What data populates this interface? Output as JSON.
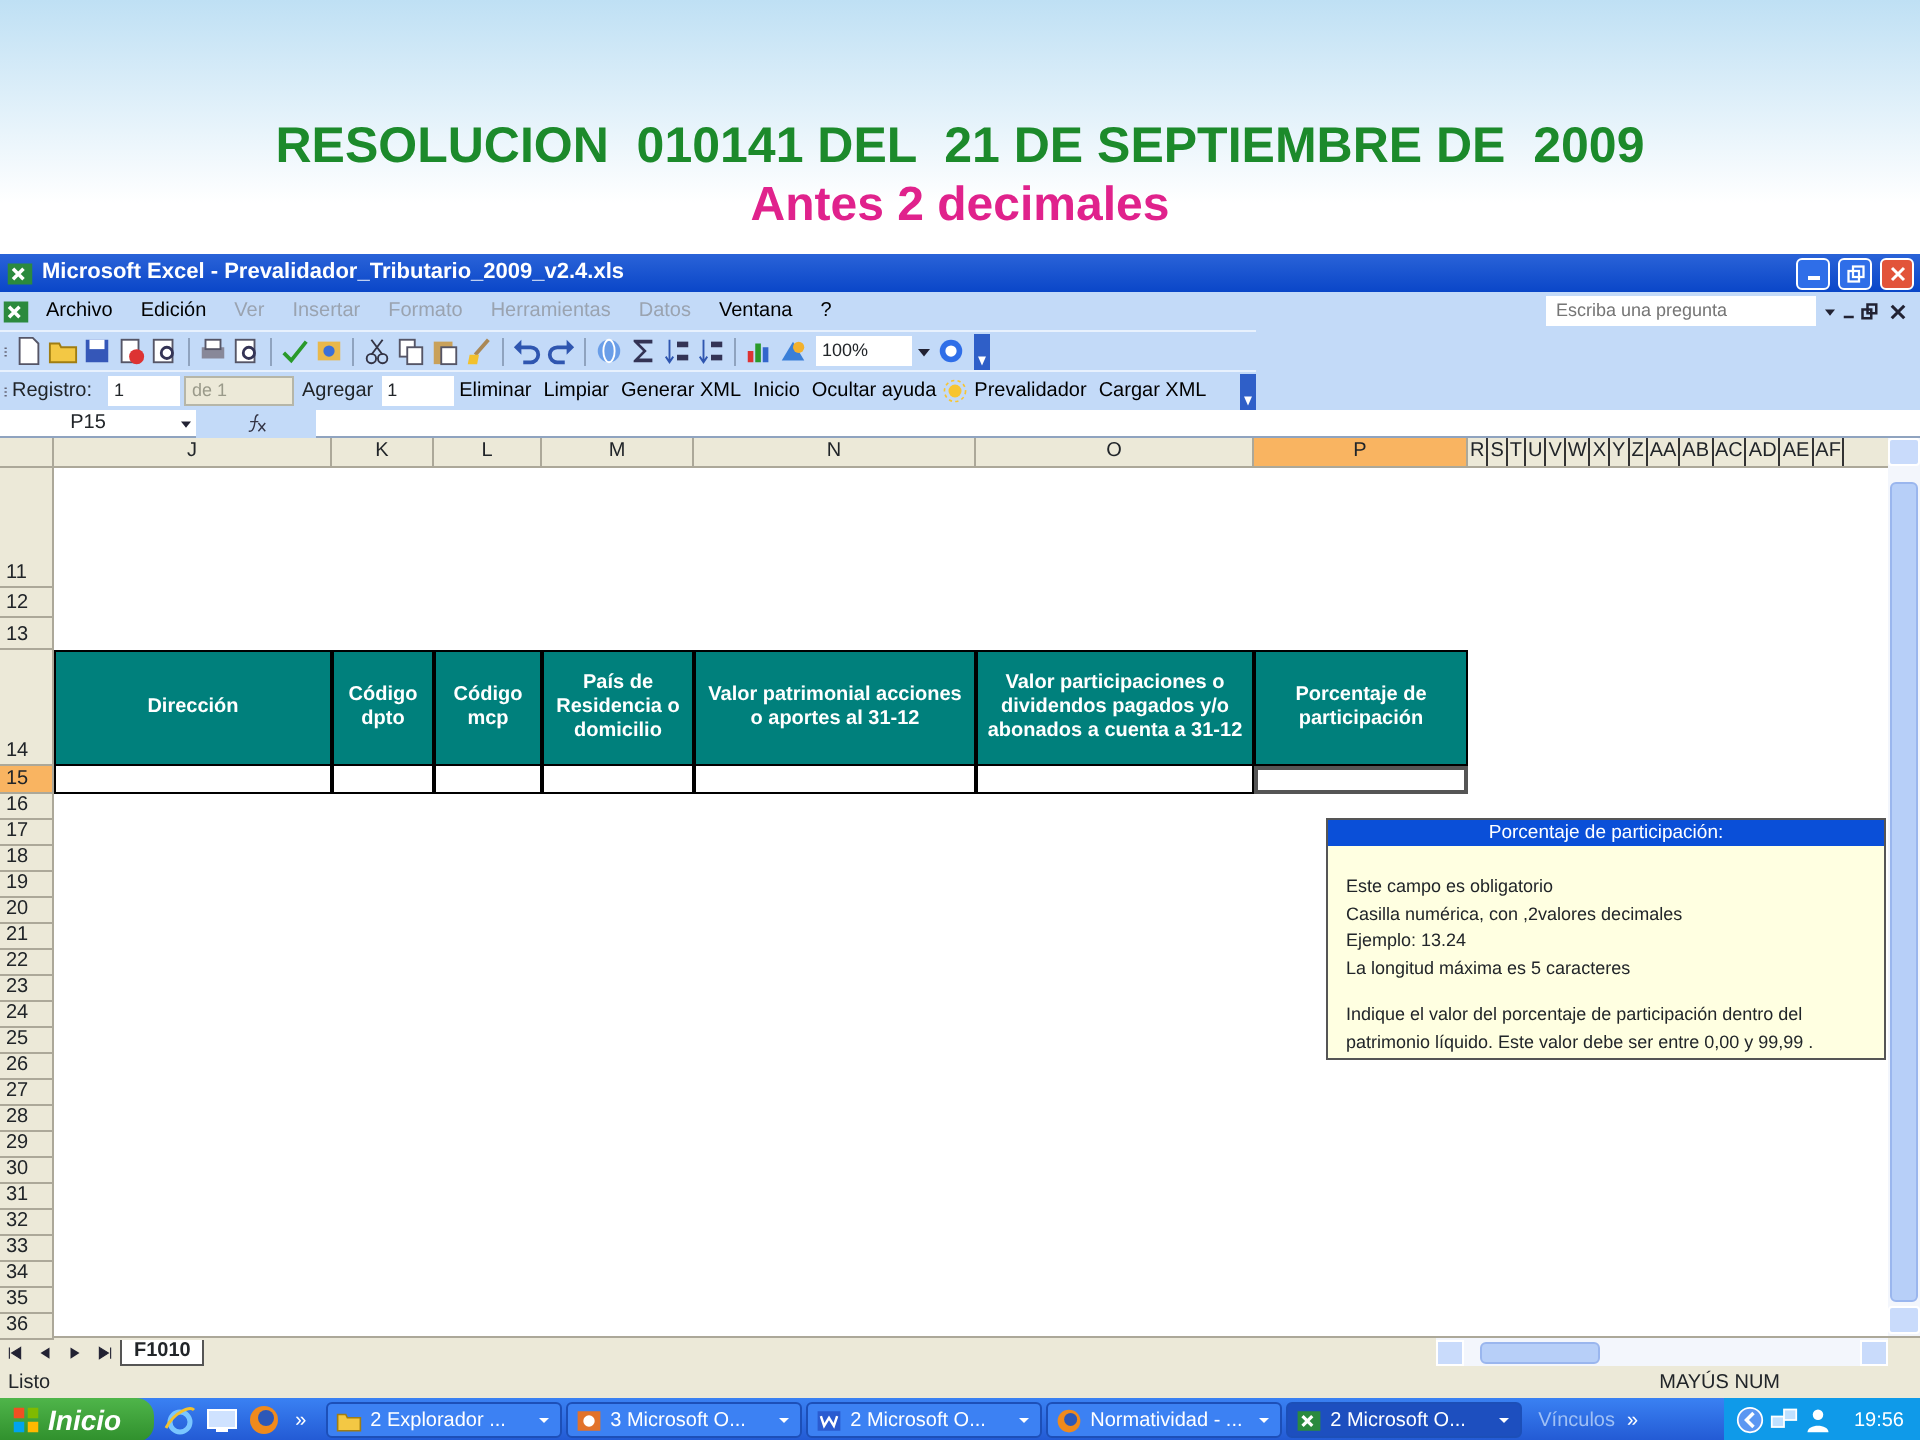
{
  "slide": {
    "title": "RESOLUCION  010141 DEL  21 DE SEPTIEMBRE DE  2009",
    "subtitle": "Antes 2 decimales"
  },
  "window": {
    "title": "Microsoft Excel - Prevalidador_Tributario_2009_v2.4.xls"
  },
  "menu": [
    {
      "label": "Archivo",
      "disabled": false
    },
    {
      "label": "Edición",
      "disabled": false
    },
    {
      "label": "Ver",
      "disabled": true
    },
    {
      "label": "Insertar",
      "disabled": true
    },
    {
      "label": "Formato",
      "disabled": true
    },
    {
      "label": "Herramientas",
      "disabled": true
    },
    {
      "label": "Datos",
      "disabled": true
    },
    {
      "label": "Ventana",
      "disabled": false
    },
    {
      "label": "?",
      "disabled": false
    }
  ],
  "help_box": {
    "placeholder": "Escriba una pregunta"
  },
  "zoom": "100%",
  "record_toolbar": {
    "label": "Registro:",
    "record": "1",
    "of_label": "de 1",
    "add_label": "Agregar",
    "add_count": "1",
    "buttons": [
      "Eliminar",
      "Limpiar",
      "Generar XML",
      "Inicio",
      "Ocultar ayuda",
      "Prevalidador",
      "Cargar XML"
    ]
  },
  "name_box": "P15",
  "column_headers": [
    {
      "label": "J",
      "selected": false
    },
    {
      "label": "K",
      "selected": false
    },
    {
      "label": "L",
      "selected": false
    },
    {
      "label": "M",
      "selected": false
    },
    {
      "label": "N",
      "selected": false
    },
    {
      "label": "O",
      "selected": false
    },
    {
      "label": "P",
      "selected": true
    }
  ],
  "extra_columns": [
    "R",
    "S",
    "T",
    "U",
    "V",
    "W",
    "X",
    "Y",
    "Z",
    "AA",
    "AB",
    "AC",
    "AD",
    "AE",
    "AF"
  ],
  "row_headers": [
    {
      "label": "11",
      "selected": false
    },
    {
      "label": "12",
      "selected": false
    },
    {
      "label": "13",
      "selected": false
    },
    {
      "label": "14",
      "selected": false
    },
    {
      "label": "15",
      "selected": true
    },
    {
      "label": "16",
      "selected": false
    },
    {
      "label": "17",
      "selected": false
    },
    {
      "label": "18",
      "selected": false
    },
    {
      "label": "19",
      "selected": false
    },
    {
      "label": "20",
      "selected": false
    },
    {
      "label": "21",
      "selected": false
    },
    {
      "label": "22",
      "selected": false
    },
    {
      "label": "23",
      "selected": false
    },
    {
      "label": "24",
      "selected": false
    },
    {
      "label": "25",
      "selected": false
    },
    {
      "label": "26",
      "selected": false
    },
    {
      "label": "27",
      "selected": false
    },
    {
      "label": "28",
      "selected": false
    },
    {
      "label": "29",
      "selected": false
    },
    {
      "label": "30",
      "selected": false
    },
    {
      "label": "31",
      "selected": false
    },
    {
      "label": "32",
      "selected": false
    },
    {
      "label": "33",
      "selected": false
    },
    {
      "label": "34",
      "selected": false
    },
    {
      "label": "35",
      "selected": false
    },
    {
      "label": "36",
      "selected": false
    }
  ],
  "form_table": {
    "columns": [
      {
        "title": "Dirección",
        "active": false
      },
      {
        "title": "Código dpto",
        "active": false
      },
      {
        "title": "Código mcp",
        "active": false
      },
      {
        "title": "País de Residencia o domicilio",
        "active": false
      },
      {
        "title": "Valor patrimonial acciones o aportes al 31-12",
        "active": false
      },
      {
        "title": "Valor participaciones o dividendos pagados y/o abonados a cuenta a 31-12",
        "active": false
      },
      {
        "title": "Porcentaje de participación",
        "active": true
      }
    ]
  },
  "tooltip": {
    "title": "Porcentaje de participación:",
    "lines": [
      "Este campo es obligatorio",
      "Casilla numérica, con ,2valores decimales",
      "Ejemplo: 13.24",
      "La longitud máxima es 5 caracteres"
    ],
    "note": "Indique el valor del porcentaje de participación dentro del patrimonio líquido. Este valor debe ser entre 0,00 y 99,99 ."
  },
  "sheet_tabs": [
    {
      "label": "F1010",
      "selected": true
    }
  ],
  "status_bar": {
    "left": "Listo",
    "indicators": "MAYÚS NUM"
  },
  "taskbar": {
    "start": "Inicio",
    "more": "»",
    "tasks": [
      {
        "label": "2 Explorador ...",
        "selected": false
      },
      {
        "label": "3 Microsoft O...",
        "selected": false
      },
      {
        "label": "2 Microsoft O...",
        "selected": false
      },
      {
        "label": "Normatividad - ...",
        "selected": false
      },
      {
        "label": "2 Microsoft O...",
        "selected": true
      }
    ],
    "links": "Vínculos",
    "links_more": "»",
    "clock": "19:56"
  }
}
